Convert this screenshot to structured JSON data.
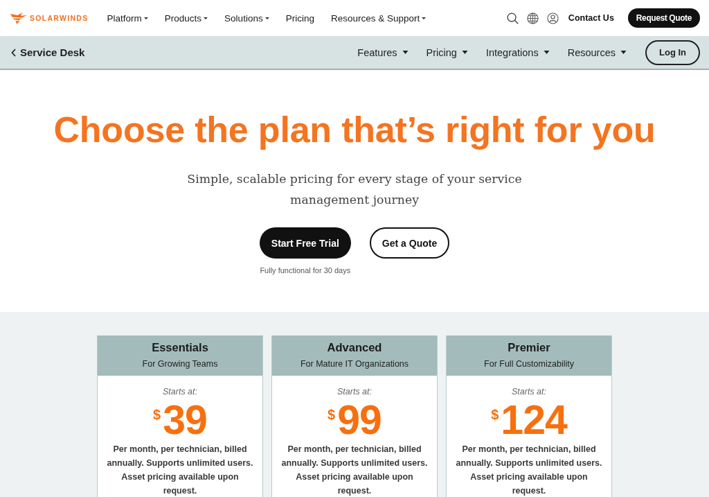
{
  "top_nav": {
    "logo_text": "SOLARWINDS",
    "items": [
      {
        "label": "Platform",
        "has_menu": true
      },
      {
        "label": "Products",
        "has_menu": true
      },
      {
        "label": "Solutions",
        "has_menu": true
      },
      {
        "label": "Pricing",
        "has_menu": false
      },
      {
        "label": "Resources & Support",
        "has_menu": true
      }
    ],
    "contact_link": "Contact Us",
    "request_button": "Request Quote"
  },
  "sub_nav": {
    "back_link": "Service Desk",
    "items": [
      {
        "label": "Features",
        "has_menu": true
      },
      {
        "label": "Pricing",
        "has_menu": true
      },
      {
        "label": "Integrations",
        "has_menu": true
      },
      {
        "label": "Resources",
        "has_menu": true
      }
    ],
    "login_button": "Log In"
  },
  "hero": {
    "title": "Choose the plan that’s right for you",
    "subtitle": "Simple, scalable pricing for every stage of your service management journey",
    "primary_button": "Start Free Trial",
    "secondary_button": "Get a Quote",
    "trial_note": "Fully functional for 30 days"
  },
  "plans": [
    {
      "name": "Essentials",
      "tagline": "For Growing Teams",
      "starts_label": "Starts at:",
      "currency": "$",
      "price": "39",
      "description": "Per month, per technician, billed annually. Supports unlimited users. Asset pricing available upon request."
    },
    {
      "name": "Advanced",
      "tagline": "For Mature IT Organizations",
      "starts_label": "Starts at:",
      "currency": "$",
      "price": "99",
      "description": "Per month, per technician, billed annually. Supports unlimited users. Asset pricing available upon request."
    },
    {
      "name": "Premier",
      "tagline": "For Full Customizability",
      "starts_label": "Starts at:",
      "currency": "$",
      "price": "124",
      "description": "Per month, per technician, billed annually. Supports unlimited users. Asset pricing available upon request."
    }
  ]
}
